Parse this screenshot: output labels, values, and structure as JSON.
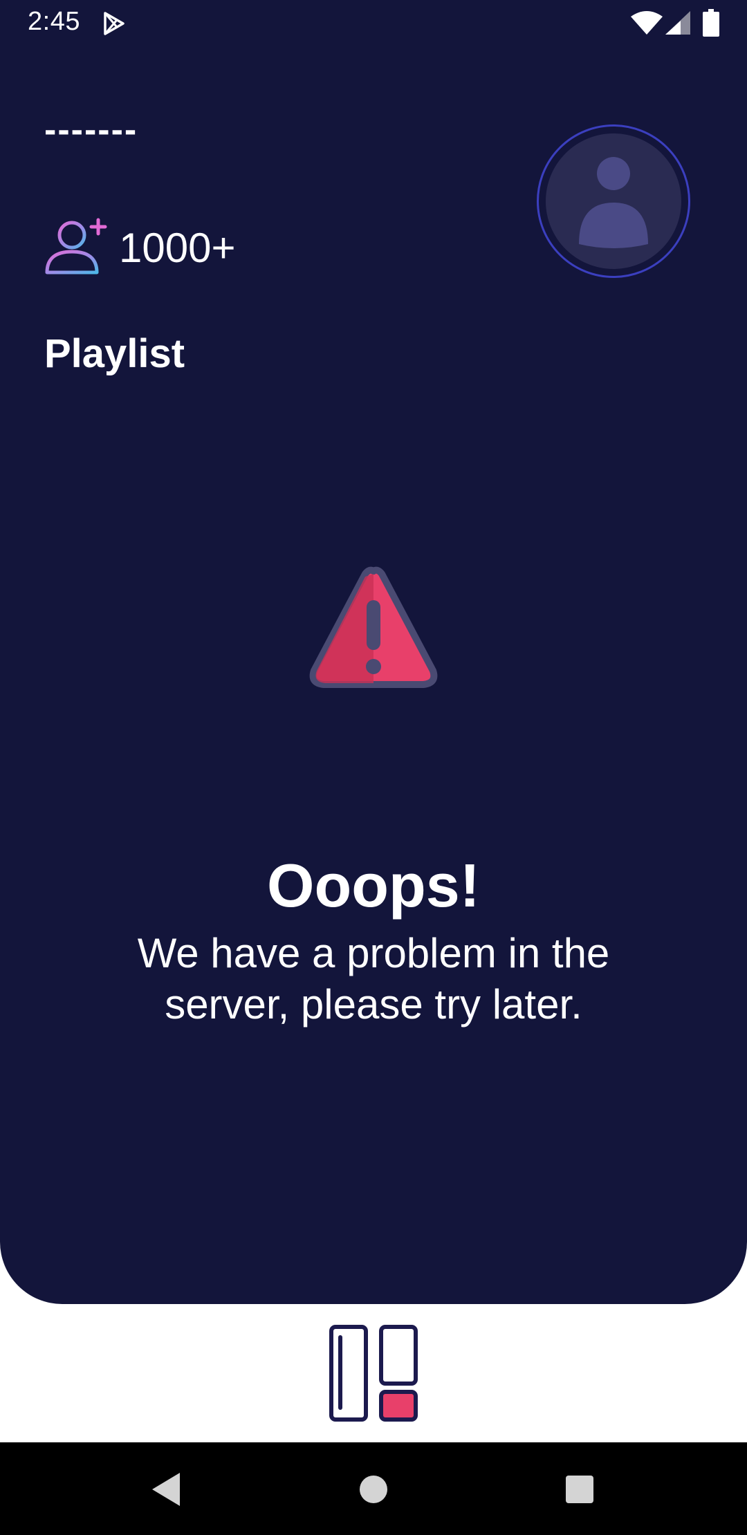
{
  "status_bar": {
    "time": "2:45",
    "icons": [
      "play-store-icon",
      "wifi-icon",
      "signal-icon",
      "battery-icon"
    ]
  },
  "header": {
    "username": "-------",
    "follower_count": "1000+",
    "follow_icon": "add-user-icon",
    "avatar_icon": "user-avatar-icon"
  },
  "section": {
    "title": "Playlist"
  },
  "error": {
    "icon": "warning-icon",
    "title": "Ooops!",
    "message": "We have a problem in the server, please try later."
  },
  "bottom_nav": {
    "icon": "layout-icon"
  },
  "system_nav": {
    "buttons": [
      "back",
      "home",
      "recents"
    ]
  },
  "colors": {
    "background": "#13153b",
    "accent": "#e8406a",
    "avatar_ring": "#3b3fbf",
    "avatar_fill": "#2a2b52"
  }
}
